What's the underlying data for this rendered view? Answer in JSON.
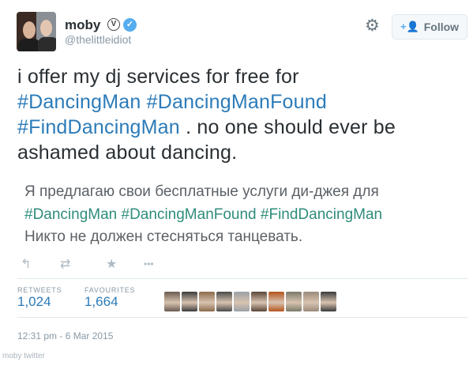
{
  "user": {
    "name": "moby",
    "badge_glyph": "V",
    "handle": "@thelittleidiot"
  },
  "follow_button": {
    "label": "Follow"
  },
  "tweet": {
    "line1": "i offer my dj services for free for",
    "tag1": "#DancingMan",
    "tag2": "#DancingManFound",
    "tag3": "#FindDancingMan",
    "line3_rest": ". no one should ever be",
    "line4": "ashamed about dancing."
  },
  "translation": {
    "line1": "Я предлагаю свои бесплатные услуги ди-джея для",
    "tags": "#DancingMan #DancingManFound #FindDancingMan",
    "line3": "Никто не должен стесняться танцевать."
  },
  "actions": [
    {
      "icon": "reply-icon",
      "glyph": "↰"
    },
    {
      "icon": "retweet-icon",
      "glyph": "⇄"
    },
    {
      "icon": "favorite-icon",
      "glyph": "★"
    },
    {
      "icon": "more-icon",
      "glyph": "•••"
    }
  ],
  "stats": {
    "retweets_label": "RETWEETS",
    "retweets_value": "1,024",
    "favourites_label": "FAVOURITES",
    "favourites_value": "1,664"
  },
  "favoriter_avatars": [
    "#6a5a50",
    "#3b3b3b",
    "#8a6a4a",
    "#4a4a4a",
    "#9aa0a6",
    "#5a4638",
    "#b4541e",
    "#7a7a6a",
    "#9a8a7a",
    "#3a3a3a"
  ],
  "timestamp": "12:31 pm - 6 Mar 2015",
  "watermark": "moby twitter"
}
